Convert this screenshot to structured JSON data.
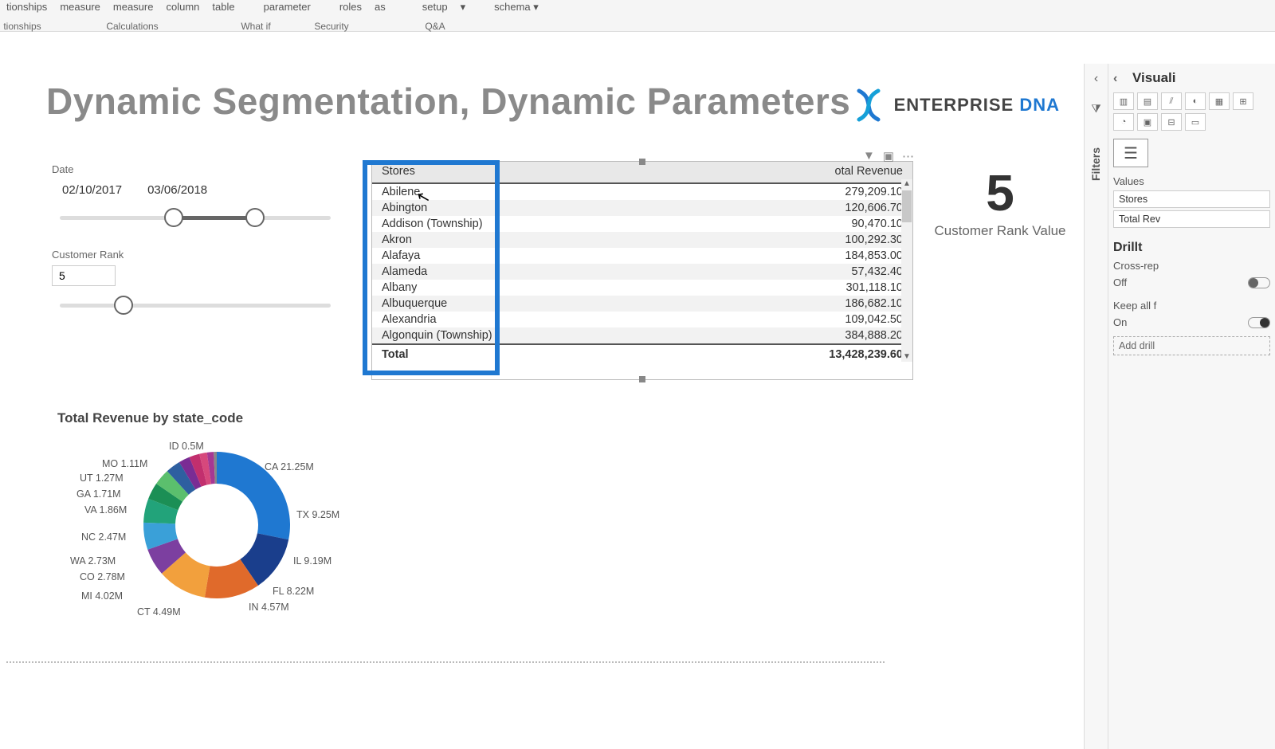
{
  "ribbon": {
    "items": [
      "tionships",
      "measure",
      "measure",
      "column",
      "table",
      "parameter",
      "roles",
      "as",
      "setup",
      "▾",
      "schema ▾"
    ],
    "groups": [
      "tionships",
      "Calculations",
      "What if",
      "Security",
      "Q&A"
    ]
  },
  "title": "Dynamic Segmentation, Dynamic Parameters",
  "logo": {
    "brand": "ENTERPRISE",
    "accent": "DNA"
  },
  "date_slicer": {
    "label": "Date",
    "start": "02/10/2017",
    "end": "03/06/2018"
  },
  "rank_slicer": {
    "label": "Customer Rank",
    "value": "5"
  },
  "table": {
    "headers": [
      "Stores",
      "otal Revenue"
    ],
    "rows": [
      {
        "store": "Abilene",
        "rev": "279,209.10"
      },
      {
        "store": "Abington",
        "rev": "120,606.70"
      },
      {
        "store": "Addison (Township)",
        "rev": "90,470.10"
      },
      {
        "store": "Akron",
        "rev": "100,292.30"
      },
      {
        "store": "Alafaya",
        "rev": "184,853.00"
      },
      {
        "store": "Alameda",
        "rev": "57,432.40"
      },
      {
        "store": "Albany",
        "rev": "301,118.10"
      },
      {
        "store": "Albuquerque",
        "rev": "186,682.10"
      },
      {
        "store": "Alexandria",
        "rev": "109,042.50"
      },
      {
        "store": "Algonquin (Township)",
        "rev": "384,888.20"
      }
    ],
    "total_label": "Total",
    "total_value": "13,428,239.60"
  },
  "card": {
    "value": "5",
    "label": "Customer Rank Value"
  },
  "donut": {
    "title": "Total Revenue by state_code"
  },
  "chart_data": {
    "type": "pie",
    "title": "Total Revenue by state_code",
    "series": [
      {
        "name": "CA",
        "label": "CA 21.25M",
        "value": 21.25
      },
      {
        "name": "TX",
        "label": "TX 9.25M",
        "value": 9.25
      },
      {
        "name": "IL",
        "label": "IL 9.19M",
        "value": 9.19
      },
      {
        "name": "FL",
        "label": "FL 8.22M",
        "value": 8.22
      },
      {
        "name": "IN",
        "label": "IN 4.57M",
        "value": 4.57
      },
      {
        "name": "CT",
        "label": "CT 4.49M",
        "value": 4.49
      },
      {
        "name": "MI",
        "label": "MI 4.02M",
        "value": 4.02
      },
      {
        "name": "CO",
        "label": "CO 2.78M",
        "value": 2.78
      },
      {
        "name": "WA",
        "label": "WA 2.73M",
        "value": 2.73
      },
      {
        "name": "NC",
        "label": "NC 2.47M",
        "value": 2.47
      },
      {
        "name": "VA",
        "label": "VA 1.86M",
        "value": 1.86
      },
      {
        "name": "GA",
        "label": "GA 1.71M",
        "value": 1.71
      },
      {
        "name": "UT",
        "label": "UT 1.27M",
        "value": 1.27
      },
      {
        "name": "MO",
        "label": "MO 1.11M",
        "value": 1.11
      },
      {
        "name": "ID",
        "label": "ID 0.5M",
        "value": 0.5
      }
    ]
  },
  "panel": {
    "filters_label": "Filters",
    "viz_title": "Visuali",
    "values_label": "Values",
    "fields": [
      "Stores",
      "Total Rev"
    ],
    "drill_title": "Drillt",
    "cross_label": "Cross-rep",
    "off_label": "Off",
    "keep_label": "Keep all f",
    "on_label": "On",
    "add_drill": "Add drill"
  }
}
